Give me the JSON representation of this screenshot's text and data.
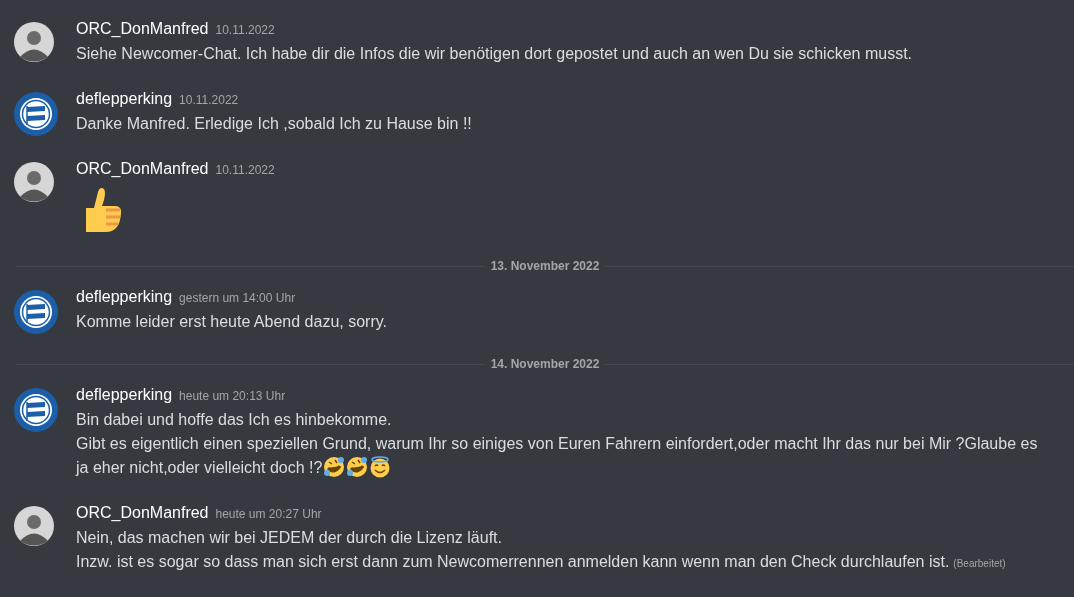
{
  "feed": [
    {
      "kind": "message",
      "author": "ORC_DonManfred",
      "avatar": {
        "kind": "photo"
      },
      "timestamp": "10.11.2022",
      "lines": [
        {
          "kind": "text",
          "text": "Siehe Newcomer-Chat. Ich habe dir die Infos die wir benötigen dort gepostet und auch an wen Du sie schicken musst."
        }
      ]
    },
    {
      "kind": "message",
      "author": "deflepperking",
      "avatar": {
        "kind": "badge"
      },
      "timestamp": "10.11.2022",
      "lines": [
        {
          "kind": "text",
          "text": "Danke Manfred. Erledige Ich ,sobald Ich zu Hause bin !!"
        }
      ]
    },
    {
      "kind": "message",
      "author": "ORC_DonManfred",
      "avatar": {
        "kind": "photo"
      },
      "timestamp": "10.11.2022",
      "lines": [
        {
          "kind": "jumbo",
          "emoji": [
            {
              "kind": "thumbs-up"
            }
          ]
        }
      ]
    },
    {
      "kind": "divider",
      "label": "13. November 2022"
    },
    {
      "kind": "message",
      "author": "deflepperking",
      "avatar": {
        "kind": "badge"
      },
      "timestamp": "gestern um 14:00 Uhr",
      "lines": [
        {
          "kind": "text",
          "text": "Komme leider erst heute Abend dazu, sorry."
        }
      ]
    },
    {
      "kind": "divider",
      "label": "14. November 2022"
    },
    {
      "kind": "message",
      "author": "deflepperking",
      "avatar": {
        "kind": "badge"
      },
      "timestamp": "heute um 20:13 Uhr",
      "lines": [
        {
          "kind": "text",
          "text": "Bin dabei und hoffe das Ich es hinbekomme."
        },
        {
          "kind": "text",
          "text": "Gibt es eigentlich einen speziellen Grund, warum Ihr so einiges von Euren Fahrern einfordert,oder macht Ihr das nur bei Mir ?Glaube es"
        },
        {
          "kind": "text",
          "text": "ja eher nicht,oder vielleicht doch !?",
          "emoji": [
            {
              "kind": "rofl"
            },
            {
              "kind": "rofl"
            },
            {
              "kind": "halo-smile"
            }
          ]
        }
      ]
    },
    {
      "kind": "message",
      "author": "ORC_DonManfred",
      "avatar": {
        "kind": "photo"
      },
      "timestamp": "heute um 20:27 Uhr",
      "lines": [
        {
          "kind": "text",
          "text": "Nein, das machen wir bei JEDEM der durch die Lizenz läuft."
        },
        {
          "kind": "text",
          "text": "Inzw. ist es sogar so dass man sich erst dann zum Newcomerrennen anmelden kann wenn man den Check durchlaufen ist.",
          "edited": "(Bearbeitet)"
        }
      ]
    }
  ]
}
